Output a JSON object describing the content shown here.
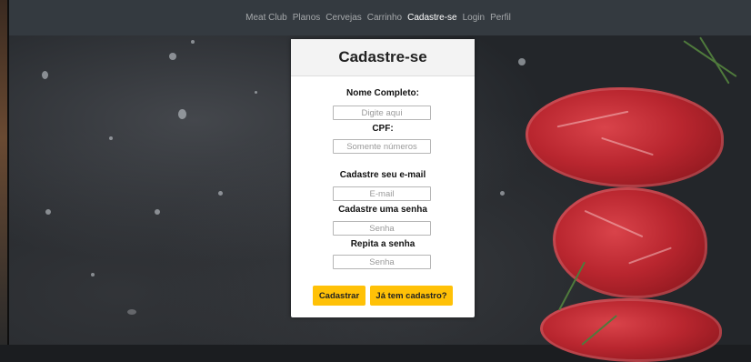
{
  "navbar": {
    "links": [
      "Meat Club",
      "Planos",
      "Cervejas",
      "Carrinho",
      "Cadastre-se",
      "Login",
      "Perfil"
    ],
    "active": "Cadastre-se"
  },
  "form": {
    "title": "Cadastre-se",
    "name_label": "Nome Completo:",
    "name_placeholder": "Digite aqui",
    "cpf_label": "CPF:",
    "cpf_placeholder": "Somente números",
    "email_label": "Cadastre seu e-mail",
    "email_placeholder": "E-mail",
    "password_label": "Cadastre uma senha",
    "password_placeholder": "Senha",
    "repeat_label": "Repita a senha",
    "repeat_placeholder": "Senha",
    "submit_label": "Cadastrar",
    "login_label": "Já tem cadastro?"
  },
  "colors": {
    "navbar": "#343a40",
    "accent": "#ffc107"
  }
}
